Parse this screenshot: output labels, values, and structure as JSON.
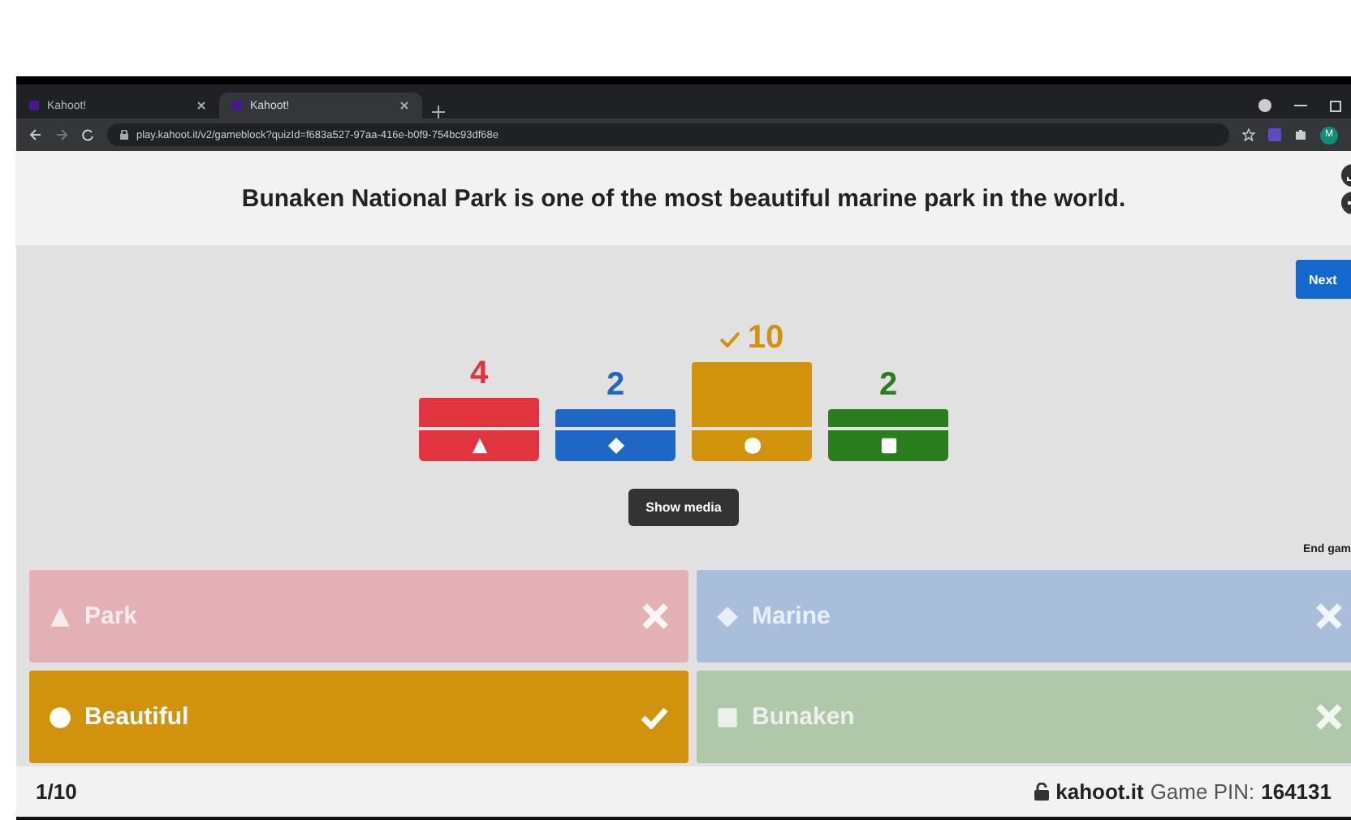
{
  "browser": {
    "tabs": [
      {
        "title": "Kahoot!",
        "selected": false
      },
      {
        "title": "Kahoot!",
        "selected": true
      }
    ],
    "url": "play.kahoot.it/v2/gameblock?quizId=f683a527-97aa-416e-b0f9-754bc93df68e",
    "profile": "M"
  },
  "question": "Bunaken National Park is one of the most beautiful marine park in the world.",
  "results": [
    {
      "count": "4",
      "kind": "triangle",
      "color": "#e0353f",
      "correct": false
    },
    {
      "count": "2",
      "kind": "diamond",
      "color": "#1f67c6",
      "correct": false
    },
    {
      "count": "10",
      "kind": "circle",
      "color": "#d0930b",
      "correct": true
    },
    {
      "count": "2",
      "kind": "square",
      "color": "#277e1a",
      "correct": false
    }
  ],
  "next_button": "Next",
  "show_media_button": "Show media",
  "end_game": "End gam",
  "answers": [
    {
      "text": "Park",
      "kind": "triangle",
      "color": "#e3b1b5",
      "correct": false
    },
    {
      "text": "Marine",
      "kind": "diamond",
      "color": "#a9bedb",
      "correct": false
    },
    {
      "text": "Beautiful",
      "kind": "circle",
      "color": "#d0930b",
      "correct": true
    },
    {
      "text": "Bunaken",
      "kind": "square",
      "color": "#afc8aa",
      "correct": false
    }
  ],
  "footer": {
    "progress": "1/10",
    "site": "kahoot.it",
    "pin_label": "Game PIN:",
    "pin": "164131"
  }
}
